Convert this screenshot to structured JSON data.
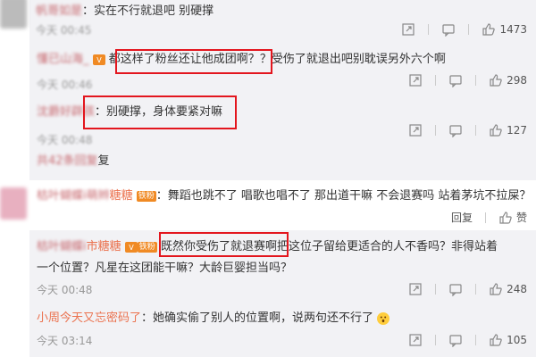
{
  "comments": [
    {
      "user": "帆哥如是",
      "text": "：实在不行就退吧 别硬撑",
      "time": "今天 00:45",
      "likes": "1473"
    },
    {
      "user": "懂已山海_",
      "text_boxed": "都这样了粉丝还让他成团啊？",
      "text_rest": "？受伤了就退出吧别耽误另外六个啊",
      "time": "今天 00:46",
      "likes": "298"
    },
    {
      "user": "沈爵好辟孩",
      "text": "：别硬撑，身体要紧对嘛",
      "time": "今天 00:48",
      "likes": "127"
    },
    {
      "user": "共42条回复",
      "text": "复"
    },
    {
      "user": "枯叶蝴蝶i萌辫",
      "name_tail": "糖糖",
      "badge": "铁粉",
      "text": "：舞蹈也跳不了 唱歌也唱不了 那出道干嘛 不会退赛吗 站着茅坑不拉屎？",
      "reply": "回复",
      "like_label": "赞"
    },
    {
      "user": "枯叶蝴蝶i",
      "name_tail": "市糖糖",
      "badge": "铁粉",
      "text_boxed": "既然你受伤了就退赛啊",
      "text_rest": "把这位子留给更适合的人不香吗？非得站着",
      "text_line2": "一个位置？凡星在这团能干嘛？大龄巨婴担当吗？",
      "time": "今天 00:48",
      "likes": "248"
    },
    {
      "user": "小周今天又忘密码了",
      "text": "：她确实偷了别人的位置啊，说两句还不行了",
      "time": "今天 03:14",
      "likes": "105"
    }
  ],
  "colors": {
    "name": "#eb7350",
    "highlight_box": "#e3161e",
    "sub_background": "#f2f2f5"
  },
  "icons": [
    "share-icon",
    "comment-icon",
    "like-icon"
  ]
}
